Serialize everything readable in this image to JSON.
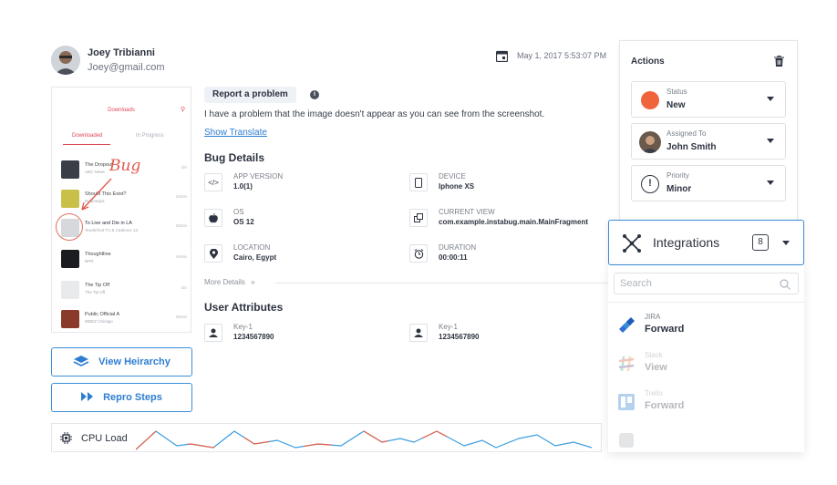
{
  "user": {
    "name": "Joey Tribianni",
    "email": "Joey@gmail.com"
  },
  "report": {
    "date": "May 1, 2017 5:53:07 PM",
    "tag": "Report a problem",
    "text": "I have a problem that the image doesn't appear as you can see from the screenshot.",
    "translate_link": "Show Translate"
  },
  "screenshot": {
    "title": "Downloads",
    "tabs": [
      "Downloaded",
      "In Progress"
    ],
    "annotation": "Bug",
    "items": [
      {
        "title": "The Dropout",
        "subtitle": "ABC News",
        "meta": "1hr",
        "color": "#3a3f47"
      },
      {
        "title": "Should This Exist?",
        "subtitle": "Radiotopia",
        "meta": "34min",
        "color": "#c9c04a"
      },
      {
        "title": "To Live and Die in LA",
        "subtitle": "Tenderfoot TV & Cadence 13",
        "meta": "29min",
        "color": "#d6d8db"
      },
      {
        "title": "Thoughtline",
        "subtitle": "NPR",
        "meta": "40min",
        "color": "#1a1c20"
      },
      {
        "title": "The Tip Off",
        "subtitle": "The Tip Off",
        "meta": "1hr",
        "color": "#e8eaec"
      },
      {
        "title": "Public Official A",
        "subtitle": "WBEZ Chicago",
        "meta": "30min",
        "color": "#8a3a2a"
      }
    ]
  },
  "buttons": {
    "view_hierarchy": "View Heirarchy",
    "repro_steps": "Repro Steps"
  },
  "cpu": {
    "label": "CPU Load"
  },
  "bug_details": {
    "heading": "Bug Details",
    "app_version_label": "APP VERSION",
    "app_version": "1.0(1)",
    "device_label": "DEVICE",
    "device": "Iphone XS",
    "os_label": "OS",
    "os": "OS 12",
    "current_view_label": "CURRENT VIEW",
    "current_view": "com.example.instabug.main.MainFragment",
    "location_label": "LOCATION",
    "location": "Cairo, Egypt",
    "duration_label": "DURATION",
    "duration": "00:00:11",
    "more_details": "More Details"
  },
  "user_attributes": {
    "heading": "User Attributes",
    "items": [
      {
        "key": "Key-1",
        "value": "1234567890"
      },
      {
        "key": "Key-1",
        "value": "1234567890"
      }
    ]
  },
  "actions": {
    "title": "Actions",
    "status_label": "Status",
    "status": "New",
    "status_color": "#f0643c",
    "assigned_label": "Assigned To",
    "assigned": "John Smith",
    "priority_label": "Priority",
    "priority": "Minor"
  },
  "integrations": {
    "label": "Integrations",
    "count": "8",
    "search_placeholder": "Search",
    "items": [
      {
        "name": "JIRA",
        "action": "Forward"
      },
      {
        "name": "Slack",
        "action": "View"
      },
      {
        "name": "Trello",
        "action": "Forward"
      }
    ]
  },
  "colors": {
    "accent": "#3a8ed8",
    "cpu_line_red": "#e8624a",
    "cpu_line_blue": "#3a9ee0"
  }
}
